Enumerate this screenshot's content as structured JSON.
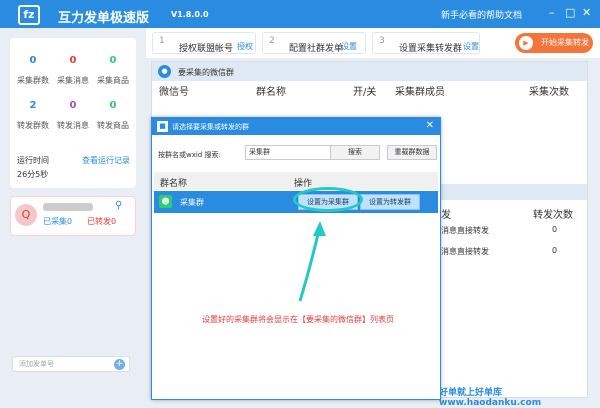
{
  "app": {
    "logo_text": "fz",
    "title": "互力发单极速版",
    "version": "V1.8.0.0",
    "help_link": "新手必看的帮助文档",
    "controls": [
      "–",
      "□",
      "✕"
    ]
  },
  "stats": [
    {
      "value": "0",
      "label": "采集群数",
      "color": "#2a8ce0"
    },
    {
      "value": "0",
      "label": "采集消息",
      "color": "#e83a3a"
    },
    {
      "value": "0",
      "label": "采集商品",
      "color": "#2ecc71"
    },
    {
      "value": "2",
      "label": "转发群数",
      "color": "#2a8ce0"
    },
    {
      "value": "0",
      "label": "转发消息",
      "color": "#9b59b6"
    },
    {
      "value": "0",
      "label": "转发商品",
      "color": "#2ecc71"
    }
  ],
  "runtime": {
    "label": "运行时间",
    "link": "查看运行记录",
    "value": "26分5秒"
  },
  "account": {
    "avatar": "Q",
    "collected": "已采集0",
    "forwarded": "已转发0"
  },
  "add_account_placeholder": "添加发单号",
  "steps": [
    {
      "num": "1",
      "text": "授权联盟帐号",
      "link": "授权"
    },
    {
      "num": "2",
      "text": "配置社群发单",
      "link": "设置"
    },
    {
      "num": "3",
      "text": "设置采集转发群",
      "link": "设置"
    }
  ],
  "start_button": "开始采集转发",
  "main": {
    "section_title": "要采集的微信群",
    "columns": [
      "微信号",
      "群名称",
      "开/关",
      "采集群成员",
      "采集次数"
    ],
    "forward_columns": [
      "发",
      "转发次数"
    ],
    "forward_rows": [
      {
        "text": "消息直接转发",
        "count": "0"
      },
      {
        "text": "消息直接转发",
        "count": "0"
      }
    ]
  },
  "dialog": {
    "title": "请选择要采集或转发的群",
    "search_label": "按群名或wxid 搜索:",
    "search_value": "采集群",
    "search_button": "搜索",
    "reload_button": "重载群数据",
    "columns": [
      "群名称",
      "操作"
    ],
    "row": {
      "name": "采集群",
      "set_collect": "设置为采集群",
      "set_forward": "设置为转发群"
    },
    "annotation": "设置好的采集群将会显示在【要采集的微信群】列表页"
  },
  "watermark": "好单就上好单库 www.haodanku.com"
}
